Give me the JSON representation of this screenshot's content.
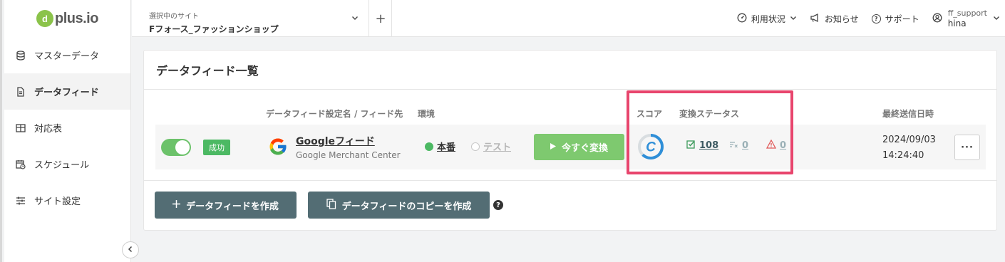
{
  "app": {
    "logo_mark": "d",
    "logo_text": "plus.io"
  },
  "sidebar": {
    "items": [
      {
        "label": "マスターデータ",
        "icon": "database-icon"
      },
      {
        "label": "データフィード",
        "icon": "document-icon"
      },
      {
        "label": "対応表",
        "icon": "table-icon"
      },
      {
        "label": "スケジュール",
        "icon": "calendar-clock-icon"
      },
      {
        "label": "サイト設定",
        "icon": "sliders-icon"
      }
    ],
    "active": "データフィード",
    "collapse_icon": "chevron-left-icon"
  },
  "header": {
    "site_caption": "選択中のサイト",
    "site_name": "Fフォース_ファッションショップ",
    "add_label": "+",
    "usage_label": "利用状況",
    "news_label": "お知らせ",
    "support_label": "サポート",
    "user_name": "ff_support",
    "user_sub": "hina"
  },
  "main": {
    "title": "データフィード一覧",
    "columns": {
      "name": "データフィード設定名 / フィード先",
      "env": "環境",
      "score": "スコア",
      "status": "変換ステータス",
      "last_sent": "最終送信日時"
    },
    "feed": {
      "enabled": true,
      "badge": "成功",
      "name": "Googleフィード",
      "destination": "Google Merchant Center",
      "env_prod": "本番",
      "env_test": "テスト",
      "env_selected": "本番",
      "convert_label": "今すぐ変換",
      "score_grade": "C",
      "stat_ok": "108",
      "stat_skip": "0",
      "stat_warn": "0",
      "last_sent_date": "2024/09/03",
      "last_sent_time": "14:24:40",
      "more_label": "···"
    },
    "create_label": "データフィードを作成",
    "copy_label": "データフィードのコピーを作成",
    "help_label": "?"
  },
  "colors": {
    "accent_green": "#4cb963",
    "button_dark": "#536d74",
    "highlight": "#e8456d",
    "score_ring": "#2f8fd8"
  }
}
